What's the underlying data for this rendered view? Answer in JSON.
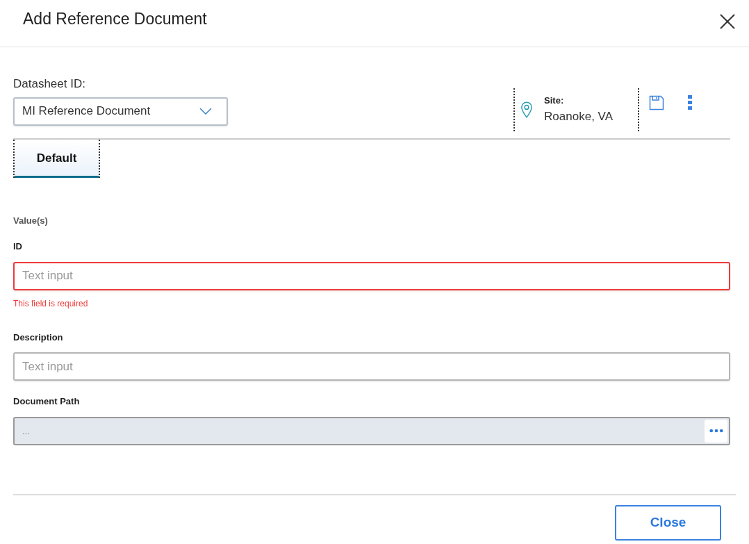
{
  "window": {
    "title": "Add Reference Document"
  },
  "datasheet": {
    "label": "Datasheet ID:",
    "value": "MI Reference Document"
  },
  "site": {
    "label": "Site:",
    "value": "Roanoke, VA"
  },
  "tabs": [
    {
      "label": "Default",
      "selected": true
    }
  ],
  "section_title": "Value(s)",
  "fields": [
    {
      "label": "ID",
      "kind": "text",
      "placeholder": "Text input",
      "error": "This field is required"
    },
    {
      "label": "Description",
      "kind": "text",
      "placeholder": "Text input"
    },
    {
      "label": "Document Path",
      "kind": "path",
      "placeholder": "..."
    }
  ],
  "buttons": [
    "Close"
  ]
}
